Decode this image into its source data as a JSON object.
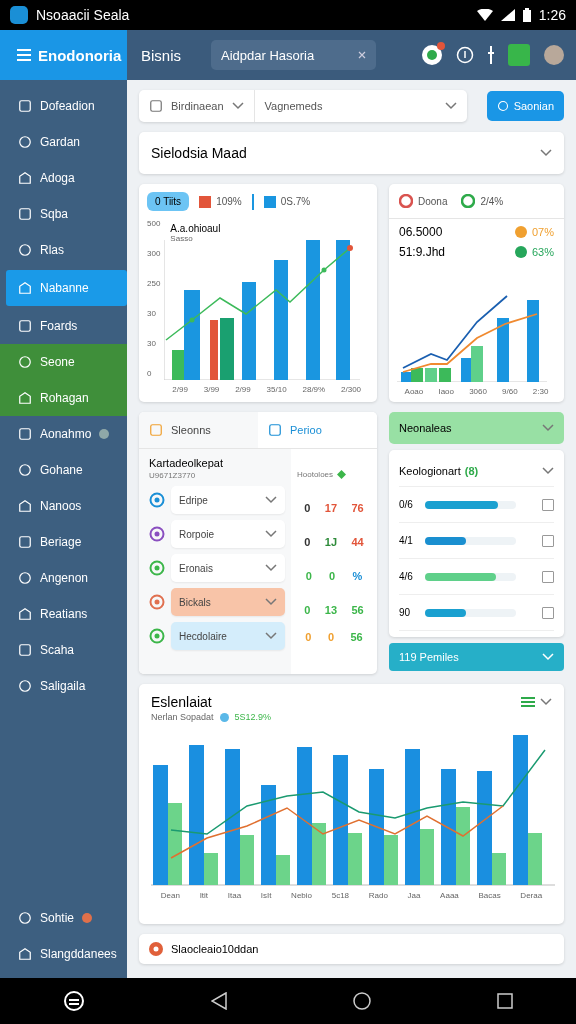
{
  "status_bar": {
    "app_name": "Nsoaacii Seala",
    "time": "1:26"
  },
  "header": {
    "brand": "Enodonoria",
    "title": "Bisnis",
    "search": {
      "value": "Aidpdar Hasoria"
    }
  },
  "sidebar": {
    "items": [
      {
        "label": "Dofeadion",
        "selected": false,
        "highlighted": false,
        "notified": false
      },
      {
        "label": "Gardan",
        "selected": false,
        "highlighted": false,
        "notified": false
      },
      {
        "label": "Adoga",
        "selected": false,
        "highlighted": false,
        "notified": false
      },
      {
        "label": "Sqba",
        "selected": false,
        "highlighted": false,
        "notified": false
      },
      {
        "label": "Rlas",
        "selected": false,
        "highlighted": false,
        "notified": false
      },
      {
        "label": "Nabanne",
        "selected": true,
        "highlighted": false,
        "notified": false
      },
      {
        "label": "Foards",
        "selected": false,
        "highlighted": false,
        "notified": false
      },
      {
        "label": "Seone",
        "selected": false,
        "highlighted": true,
        "notified": false
      },
      {
        "label": "Rohagan",
        "selected": false,
        "highlighted": true,
        "notified": false
      },
      {
        "label": "Aonahmo",
        "selected": false,
        "highlighted": false,
        "notified": true
      },
      {
        "label": "Gohane",
        "selected": false,
        "highlighted": false,
        "notified": false
      },
      {
        "label": "Nanoos",
        "selected": false,
        "highlighted": false,
        "notified": false
      },
      {
        "label": "Beriage",
        "selected": false,
        "highlighted": false,
        "notified": false
      },
      {
        "label": "Angenon",
        "selected": false,
        "highlighted": false,
        "notified": false
      },
      {
        "label": "Reatians",
        "selected": false,
        "highlighted": false,
        "notified": false
      },
      {
        "label": "Scaha",
        "selected": false,
        "highlighted": false,
        "notified": false
      },
      {
        "label": "Saligaila",
        "selected": false,
        "highlighted": false,
        "notified": false
      }
    ],
    "footer_items": [
      {
        "label": "Sohtie",
        "notified": true
      },
      {
        "label": "Slangddanees",
        "notified": false
      }
    ]
  },
  "filters": [
    {
      "label": "Birdinaean"
    },
    {
      "label": "Vagnemeds"
    }
  ],
  "action": "Saonian",
  "summary": {
    "title": "Sielodsia Maad"
  },
  "chart_left": {
    "filter": {
      "label": "0 Tiits",
      "selected": true
    },
    "legend": [
      {
        "label": "109%",
        "color": "#e2553a"
      },
      {
        "label": "0S.7%",
        "color": "#1a96e0"
      }
    ],
    "title": "A.a.ohioaul",
    "subtitle": "Sasso",
    "y_ticks": [
      "500",
      "300",
      "250",
      "30",
      "30",
      "0"
    ],
    "x_labels": [
      "2/99",
      "3/99",
      "2/99",
      "35/10",
      "28/9%",
      "2/300"
    ]
  },
  "chart_right": {
    "header": [
      {
        "label": "Doona",
        "color": "#d9534f"
      },
      {
        "label": "2/4%",
        "color": "#2eaa4a"
      }
    ],
    "stats": [
      {
        "value": "06.5000",
        "change": "07%",
        "color": "#f0a030"
      },
      {
        "value": "51:9.Jhd",
        "change": "63%",
        "color": "#26a65b"
      }
    ],
    "x_labels": [
      "Aoao",
      "Iaoo",
      "3060",
      "9/60",
      "2:30"
    ]
  },
  "panel": {
    "tabs": [
      {
        "label": "Sleonns",
        "selected": false
      },
      {
        "label": "Perioo",
        "selected": true
      }
    ],
    "title": "Kartadeolkepat",
    "subtitle": "U9671Z3770",
    "rows": [
      {
        "label": "Edripe",
        "color": "#1a8fd6",
        "kind": "plain"
      },
      {
        "label": "Rorpoie",
        "color": "#8a4fc0",
        "kind": "plain"
      },
      {
        "label": "Eronais",
        "color": "#3cb64a",
        "kind": "plain"
      },
      {
        "label": "Bickals",
        "color": "#e07050",
        "kind": "warning"
      },
      {
        "label": "Hecdolaire",
        "color": "#3cb64a",
        "kind": "info"
      }
    ],
    "column_title": "Hootoloes",
    "values": [
      [
        "0",
        "17",
        "76"
      ],
      [
        "0",
        "1J",
        "44"
      ],
      [
        "0",
        "0",
        "%"
      ],
      [
        "0",
        "13",
        "56"
      ],
      [
        "0",
        "0",
        "56"
      ]
    ]
  },
  "progress": {
    "header": "Neonaleas",
    "title": "Keologionart",
    "count": "(8)",
    "items": [
      {
        "label": "0/6",
        "level": 0.8,
        "color": "#1aa0d0",
        "checked": false
      },
      {
        "label": "4/1",
        "level": 0.45,
        "color": "#1a8fd0",
        "checked": false
      },
      {
        "label": "4/6",
        "level": 0.78,
        "color": "#5fd08a",
        "checked": false
      },
      {
        "label": "90",
        "level": 0.45,
        "color": "#1aa0d0",
        "checked": false
      }
    ],
    "footer": "119 Pemiles"
  },
  "chart_bottom": {
    "title": "Eslenlaiat",
    "subtitle": "Nerlan Sopadat",
    "value": "5S12.9%",
    "x_labels": [
      "Dean",
      "Itit",
      "Itaa",
      "IsIt",
      "Nebio",
      "5c18",
      "Rado",
      "Jaa",
      "Aaaa",
      "Bacas",
      "Deraa"
    ]
  },
  "notice": {
    "text": "Slaocleaio10ddan"
  }
}
